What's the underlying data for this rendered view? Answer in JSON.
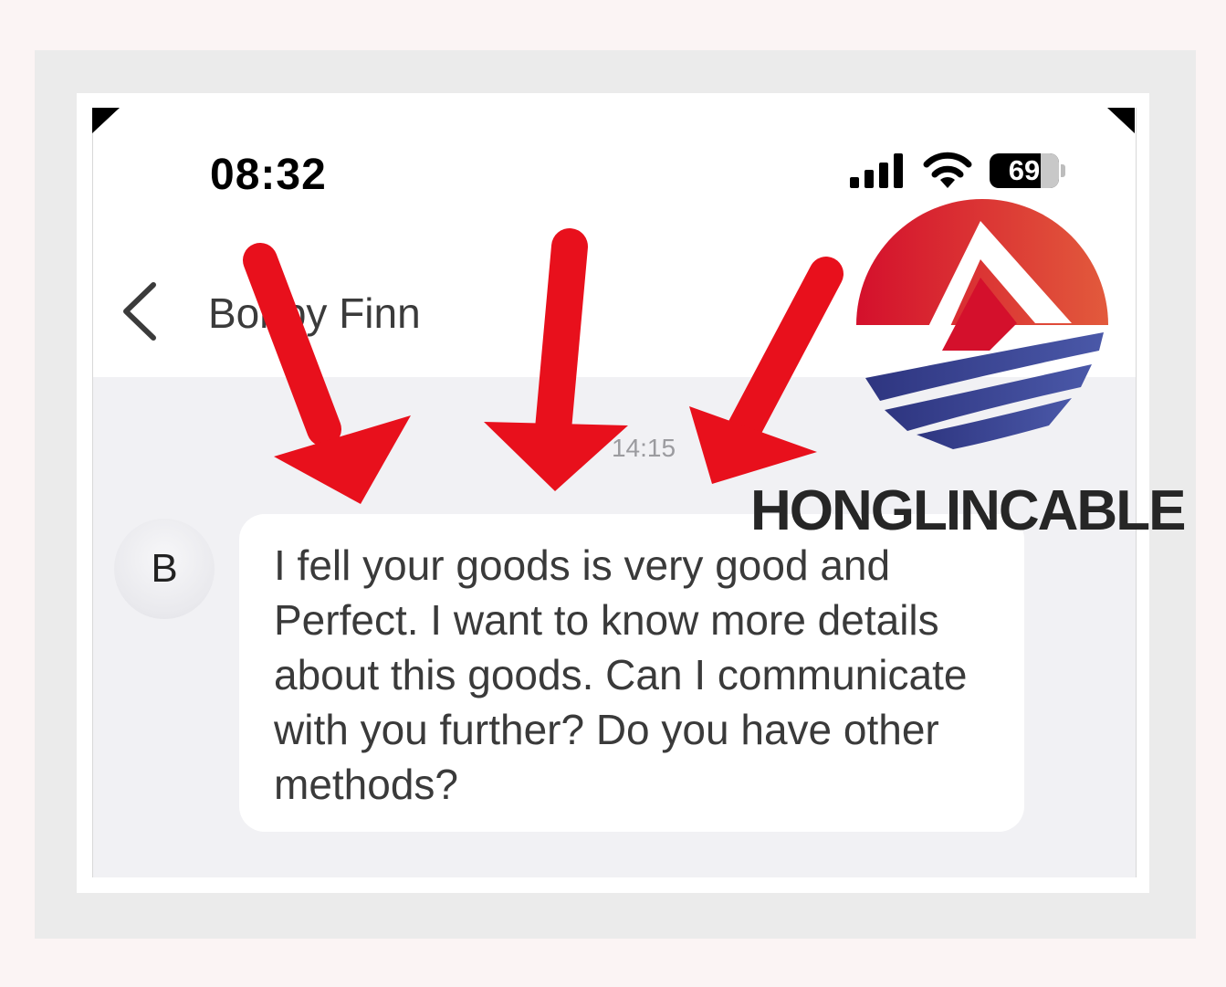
{
  "status_bar": {
    "time": "08:32",
    "battery_level": "69",
    "signal_icon": "cellular-signal-icon",
    "wifi_icon": "wifi-icon",
    "battery_icon": "battery-icon"
  },
  "header": {
    "back_icon": "chevron-left-icon",
    "contact_name": "Bobby Finn"
  },
  "conversation": {
    "timestamp": "14:15",
    "messages": [
      {
        "sender_initial": "B",
        "text": "I fell your goods is very good and Perfect. I want to know more details about this goods. Can I communicate with you further? Do you have other methods?"
      }
    ]
  },
  "overlay": {
    "brand_text": "HONGLINCABLE",
    "arrow_color": "#e8101c",
    "logo_red": "#d4102c",
    "logo_blue": "#3a3f8f"
  }
}
